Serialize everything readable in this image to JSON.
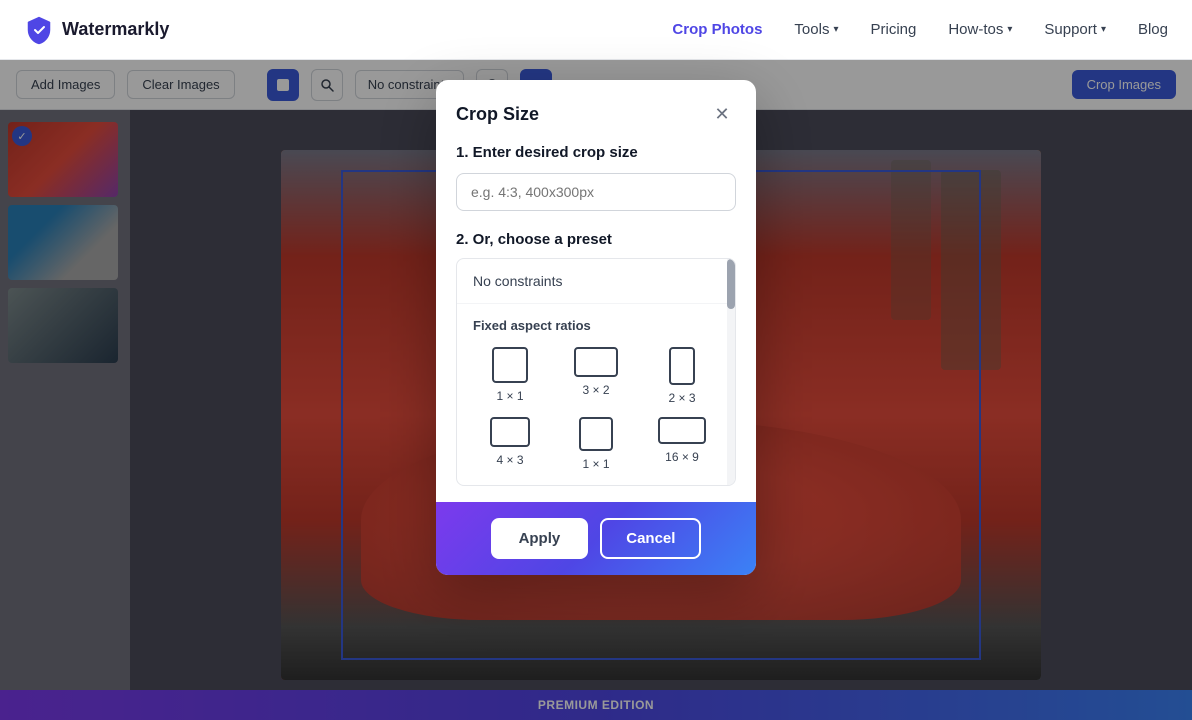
{
  "app": {
    "name": "Watermarkly",
    "logo_icon": "shield"
  },
  "navbar": {
    "logo_text": "Watermarkly",
    "active_page": "Crop Photos",
    "nav_items": [
      {
        "id": "crop-photos",
        "label": "Crop Photos",
        "active": true,
        "has_dropdown": false
      },
      {
        "id": "tools",
        "label": "Tools",
        "active": false,
        "has_dropdown": true
      },
      {
        "id": "pricing",
        "label": "Pricing",
        "active": false,
        "has_dropdown": false
      },
      {
        "id": "how-tos",
        "label": "How-tos",
        "active": false,
        "has_dropdown": true
      },
      {
        "id": "support",
        "label": "Support",
        "active": false,
        "has_dropdown": true
      },
      {
        "id": "blog",
        "label": "Blog",
        "active": false,
        "has_dropdown": false
      }
    ]
  },
  "toolbar": {
    "add_images_label": "Add Images",
    "clear_images_label": "Clear Images",
    "constraints_label": "No constraints",
    "crop_images_label": "Crop Images"
  },
  "modal": {
    "title": "Crop Size",
    "step1_heading": "1. Enter desired crop size",
    "input_placeholder": "e.g. 4:3, 400x300px",
    "step2_heading": "2. Or, choose a preset",
    "no_constraints_label": "No constraints",
    "fixed_ratios_heading": "Fixed aspect ratios",
    "presets": [
      {
        "id": "1x1",
        "label": "1 × 1",
        "shape": "square"
      },
      {
        "id": "3x2",
        "label": "3 × 2",
        "shape": "landscape"
      },
      {
        "id": "2x3",
        "label": "2 × 3",
        "shape": "portrait"
      },
      {
        "id": "4x3",
        "label": "4 × 3",
        "shape": "landscape2"
      },
      {
        "id": "1x1b",
        "label": "1 × 1",
        "shape": "square2"
      },
      {
        "id": "16x9",
        "label": "16 × 9",
        "shape": "wide"
      }
    ],
    "apply_label": "Apply",
    "cancel_label": "Cancel"
  },
  "premium": {
    "banner_text": "PREMIUM EDITION"
  }
}
